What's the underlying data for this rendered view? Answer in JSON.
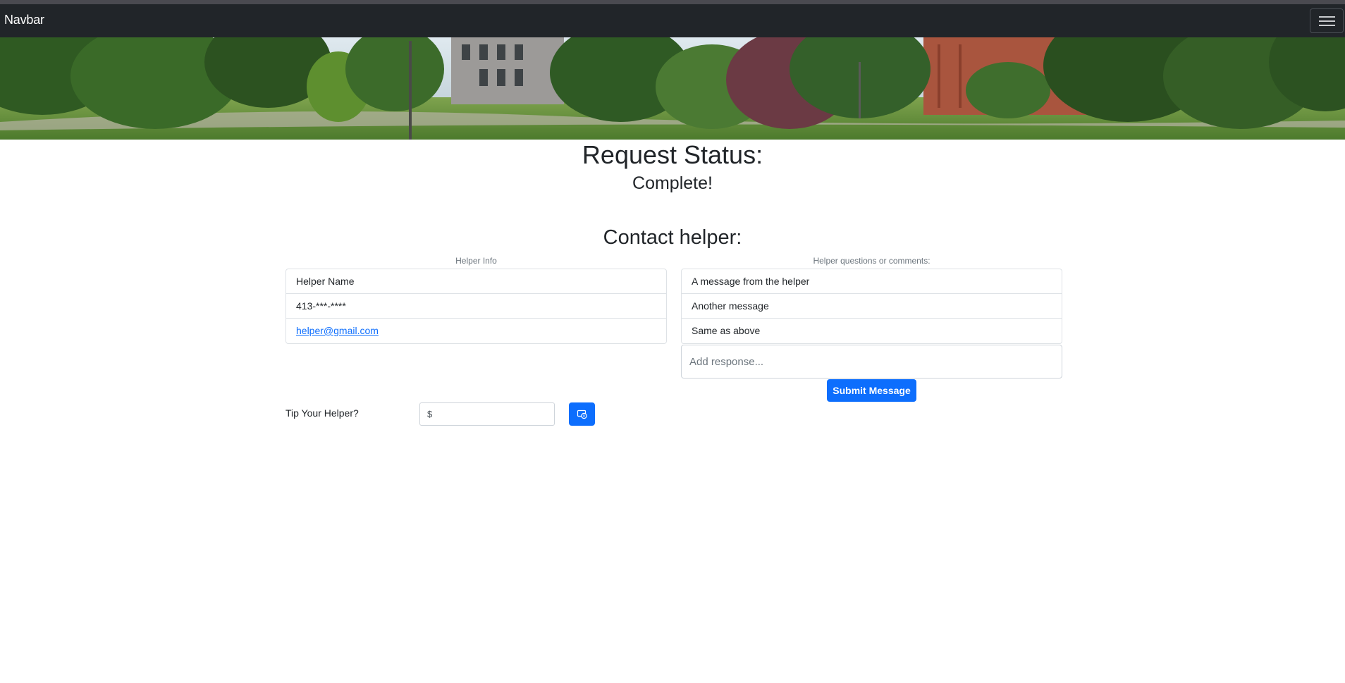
{
  "navbar": {
    "brand": "Navbar",
    "toggler_icon": "hamburger-menu-icon"
  },
  "hero": {
    "alt": "campus-photo-banner"
  },
  "status": {
    "heading": "Request Status:",
    "value": "Complete!"
  },
  "contact": {
    "heading": "Contact helper:"
  },
  "helper_info": {
    "caption": "Helper Info",
    "name": "Helper Name",
    "phone": "413-***-****",
    "email": "helper@gmail.com"
  },
  "comments": {
    "caption": "Helper questions or comments:",
    "messages": [
      "A message from the helper",
      "Another message",
      "Same as above"
    ],
    "response_placeholder": "Add response...",
    "submit_label": "Submit Message"
  },
  "tip": {
    "label": "Tip Your Helper?",
    "currency_symbol": "$",
    "value": "",
    "button_icon": "cash-tip-icon"
  },
  "colors": {
    "navbar_bg": "#212529",
    "primary": "#0d6efd",
    "link": "#0d6efd"
  }
}
